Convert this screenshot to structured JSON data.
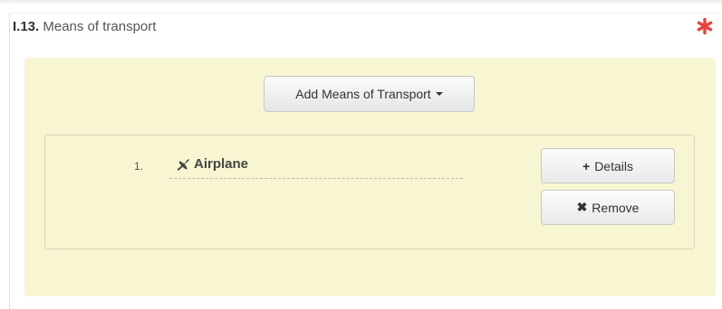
{
  "section": {
    "code": "I.13.",
    "title": "Means of transport",
    "required_marker": "*"
  },
  "add_button": {
    "label": "Add Means of Transport",
    "icon": "caret-down-icon"
  },
  "transports": [
    {
      "number": "1.",
      "icon": "plane-icon",
      "name": "Airplane",
      "details_icon": "+",
      "details_label": "Details",
      "remove_icon": "✖",
      "remove_label": "Remove"
    }
  ],
  "colors": {
    "required": "#e8403a",
    "panel_background": "#f8f6d2",
    "border": "#d8d8bb"
  }
}
